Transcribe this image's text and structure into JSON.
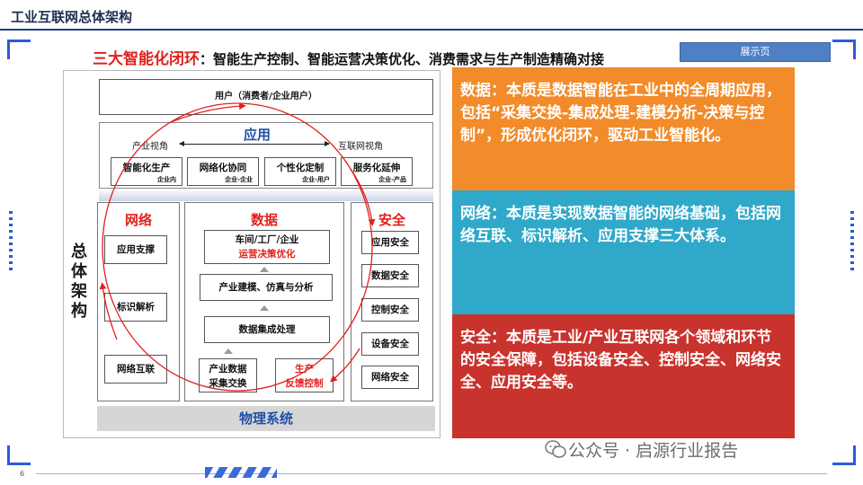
{
  "header": {
    "title": "工业互联网总体架构",
    "page_number": "6"
  },
  "subtitle": {
    "highlight": "三大智能化闭环",
    "rest": "：智能生产控制、智能运营决策优化、消费需求与生产制造精确对接"
  },
  "show_button": {
    "label": "展示页"
  },
  "architecture": {
    "side_label": "总体架构",
    "user_box": "用户（消费者/企业用户）",
    "application": {
      "title": "应用",
      "left_view": "产业视角",
      "right_view": "互联网视角",
      "items": [
        {
          "label": "智能化生产",
          "sub": "企业内"
        },
        {
          "label": "网络化协同",
          "sub": "企业-企业"
        },
        {
          "label": "个性化定制",
          "sub": "企业-用户"
        },
        {
          "label": "服务化延伸",
          "sub": "企业-产品"
        }
      ]
    },
    "network": {
      "title": "网络",
      "items": [
        "应用支撑",
        "标识解析",
        "网络互联"
      ]
    },
    "data": {
      "title": "数据",
      "top_line1": "车间/工厂/企业",
      "top_line2": "运营决策优化",
      "modeling": "产业建模、仿真与分析",
      "integration": "数据集成处理",
      "exchange_line1": "产业数据",
      "exchange_line2": "采集交换",
      "feedback_line1": "生产",
      "feedback_line2": "反馈控制"
    },
    "security": {
      "title": "安全",
      "items": [
        "应用安全",
        "数据安全",
        "控制安全",
        "设备安全",
        "网络安全"
      ]
    },
    "physical": "物理系统"
  },
  "info_panels": [
    {
      "text": "数据：本质是数据智能在工业中的全周期应用，包括“采集交换-集成处理-建模分析-决策与控制”，形成优化闭环，驱动工业智能化。",
      "color": "#f28b2a"
    },
    {
      "text": "网络：本质是实现数据智能的网络基础，包括网络互联、标识解析、应用支撑三大体系。",
      "color": "#2fa8c9"
    },
    {
      "text": "安全：本质是工业/产业互联网各个领域和环节的安全保障，包括设备安全、控制安全、网络安全、应用安全等。",
      "color": "#c8332e"
    }
  ],
  "watermark": "公众号 · 启源行业报告",
  "colors": {
    "accent_red": "#e0211d",
    "accent_blue": "#1f4fa8",
    "frame_blue": "#2a5bd7"
  }
}
